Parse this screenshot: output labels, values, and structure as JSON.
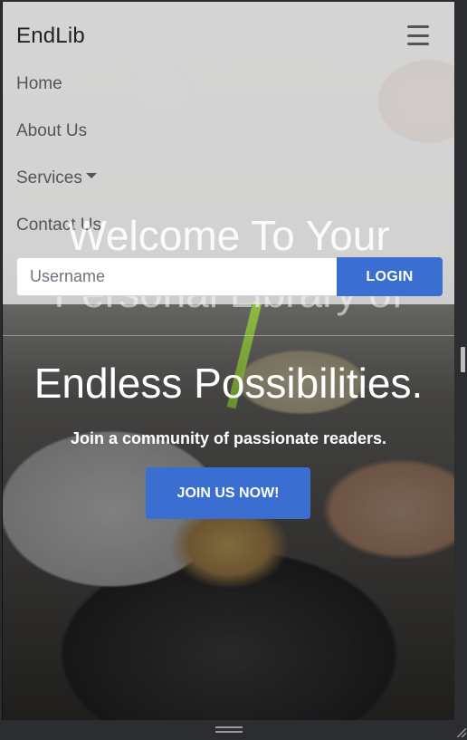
{
  "navbar": {
    "brand": "EndLib",
    "links": [
      "Home",
      "About Us",
      "Services",
      "Contact Us"
    ],
    "menu_icon": "hamburger-icon"
  },
  "search": {
    "placeholder": "Username",
    "button_label": "LOGIN"
  },
  "hero": {
    "title_line1": "Welcome To Your",
    "title_line2": "Personal Library of",
    "title_line3": "Endless Possibilities.",
    "tagline": "Join a community of passionate readers.",
    "cta_label": "JOIN US NOW!"
  },
  "colors": {
    "accent": "#3a6fd1",
    "frame": "#2b2d31"
  }
}
